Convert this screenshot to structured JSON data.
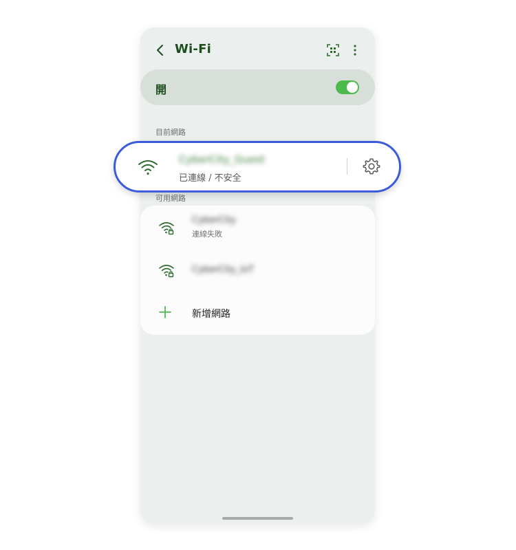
{
  "header": {
    "title": "Wi-Fi",
    "back_icon": "chevron-left-icon",
    "qr_icon": "qr-scan-icon",
    "more_icon": "more-vertical-icon"
  },
  "wifi_toggle": {
    "label": "開",
    "state": "on"
  },
  "current_section": {
    "label": "目前網路",
    "network": {
      "name": "CyberCity_Guest",
      "status": "已連線 / 不安全",
      "icon": "wifi-icon",
      "settings_icon": "gear-icon"
    }
  },
  "available_section": {
    "label": "可用網路",
    "networks": [
      {
        "name": "CyberCity",
        "status": "連線失敗",
        "icon": "wifi-lock-icon"
      },
      {
        "name": "CyberCity_IoT",
        "status": "",
        "icon": "wifi-lock-icon"
      }
    ],
    "add_label": "新增網路",
    "add_icon": "plus-icon"
  },
  "colors": {
    "accent_green": "#4cbb4c",
    "title_green": "#1c4d1c",
    "highlight_blue": "#3b5bdb"
  }
}
